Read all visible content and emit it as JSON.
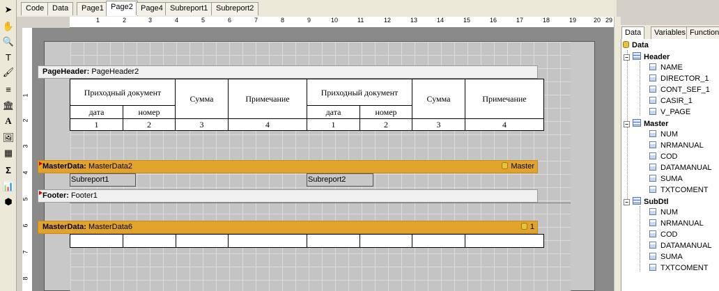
{
  "tabs": [
    "Code",
    "Data",
    "Page1",
    "Page2",
    "Page4",
    "Subreport1",
    "Subreport2"
  ],
  "active_tab": "Page2",
  "ruler_h": [
    "1",
    "2",
    "3",
    "4",
    "5",
    "6",
    "7",
    "8",
    "9",
    "10",
    "11",
    "12",
    "13",
    "14",
    "15",
    "16",
    "17",
    "18",
    "19",
    "20",
    "29"
  ],
  "ruler_v": [
    "1",
    "2",
    "3",
    "4",
    "5",
    "6",
    "7",
    "8"
  ],
  "page_header": {
    "kind": "PageHeader:",
    "name": "PageHeader2"
  },
  "table": {
    "group1": "Приходный документ",
    "sum": "Сумма",
    "note": "Примечание",
    "date": "дата",
    "number": "номер",
    "n1": "1",
    "n2": "2",
    "n3": "3",
    "n4": "4"
  },
  "master1": {
    "kind": "MasterData:",
    "name": "MasterData2",
    "source": "Master"
  },
  "sub1": "Subreport1",
  "sub2": "Subreport2",
  "footer": {
    "kind": "Footer:",
    "name": "Footer1"
  },
  "master2": {
    "kind": "MasterData:",
    "name": "MasterData6",
    "source": "1"
  },
  "panel_tabs": [
    "Data",
    "Variables",
    "Functions"
  ],
  "tree": {
    "root": "Data",
    "groups": [
      {
        "name": "Header",
        "fields": [
          "NAME",
          "DIRECTOR_1",
          "CONT_SEF_1",
          "CASIR_1",
          "V_PAGE"
        ]
      },
      {
        "name": "Master",
        "fields": [
          "NUM",
          "NRMANUAL",
          "COD",
          "DATAMANUAL",
          "SUMA",
          "TXTCOMENT"
        ]
      },
      {
        "name": "SubDtl",
        "fields": [
          "NUM",
          "NRMANUAL",
          "COD",
          "DATAMANUAL",
          "SUMA",
          "TXTCOMENT"
        ]
      }
    ]
  }
}
